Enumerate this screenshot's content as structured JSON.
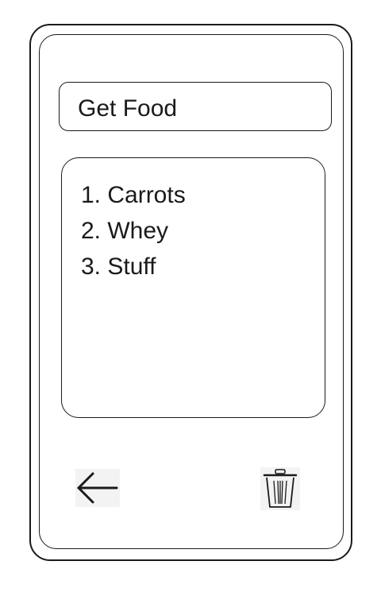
{
  "header": {
    "title_value": "Get Food"
  },
  "list": {
    "items": [
      {
        "label": "1. Carrots"
      },
      {
        "label": "2. Whey"
      },
      {
        "label": "3. Stuff"
      }
    ]
  },
  "toolbar": {
    "back_icon": "arrow-left-icon",
    "delete_icon": "trash-icon"
  }
}
